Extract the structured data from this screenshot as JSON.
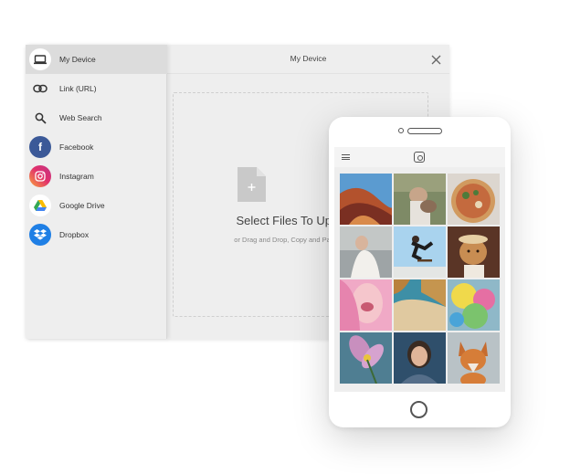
{
  "sidebar": {
    "items": [
      {
        "label": "My Device",
        "icon": "laptop-icon",
        "active": true
      },
      {
        "label": "Link (URL)",
        "icon": "link-icon"
      },
      {
        "label": "Web Search",
        "icon": "search-icon"
      },
      {
        "label": "Facebook",
        "icon": "facebook-icon",
        "color": "#3b5998"
      },
      {
        "label": "Instagram",
        "icon": "instagram-icon",
        "color": "#e1306c"
      },
      {
        "label": "Google Drive",
        "icon": "google-drive-icon"
      },
      {
        "label": "Dropbox",
        "icon": "dropbox-icon",
        "color": "#1f7fe5"
      }
    ]
  },
  "header": {
    "title": "My Device"
  },
  "upload": {
    "title": "Select Files To Upload",
    "subtitle": "or Drag and Drop, Copy and Paste Files"
  },
  "phone": {
    "app_icon": "instagram-icon",
    "photos": [
      "canyon-arch-photo",
      "woman-with-dog-photo",
      "pizza-photo",
      "bride-photo",
      "skateboarder-photo",
      "dog-in-hat-photo",
      "pink-face-photo",
      "beach-cove-photo",
      "color-festival-photo",
      "pink-flower-photo",
      "smiling-woman-photo",
      "fox-photo"
    ]
  },
  "colors": {
    "accent_facebook": "#3b5998",
    "accent_dropbox": "#1f7fe5",
    "window_bg": "#eeeeee"
  }
}
